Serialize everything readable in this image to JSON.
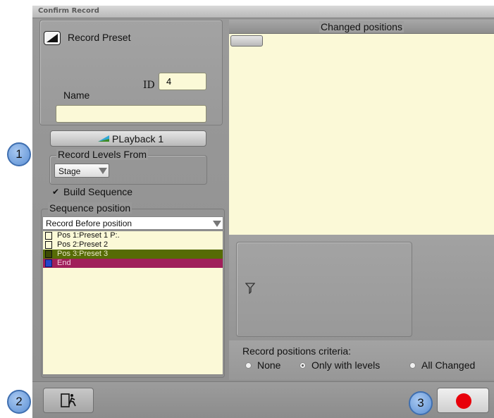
{
  "window": {
    "title": "Confirm Record"
  },
  "record": {
    "type_label": "Record Preset",
    "id_label": "ID",
    "id_value": "4",
    "name_label": "Name",
    "name_value": ""
  },
  "playback": {
    "label": "PLayback 1"
  },
  "record_levels": {
    "legend": "Record Levels From",
    "selected": "Stage"
  },
  "build_sequence": {
    "label": "Build Sequence",
    "checked": true
  },
  "sequence_position": {
    "legend": "Sequence position",
    "selected": "Record Before position",
    "items": [
      {
        "label": "Pos 1:Preset  1   P:.",
        "bg": "#fbf9d7",
        "color": "#111111"
      },
      {
        "label": "Pos 2:Preset  2",
        "bg": "#fbf9d7",
        "color": "#111111"
      },
      {
        "label": "Pos 3:Preset  3",
        "bg": "#566b05",
        "color": "#e8e8c8"
      },
      {
        "label": "End",
        "bg": "#a0205a",
        "color": "#f2d0e0"
      }
    ]
  },
  "changed_positions": {
    "title": "Changed positions"
  },
  "criteria": {
    "label": "Record positions criteria:",
    "options": [
      "None",
      "Only with levels",
      "All Changed"
    ],
    "selected": "Only with levels"
  },
  "callouts": [
    "1",
    "2",
    "3"
  ],
  "colors": {
    "record_red": "#e8000a",
    "yellow_bg": "#fbf9d7"
  }
}
